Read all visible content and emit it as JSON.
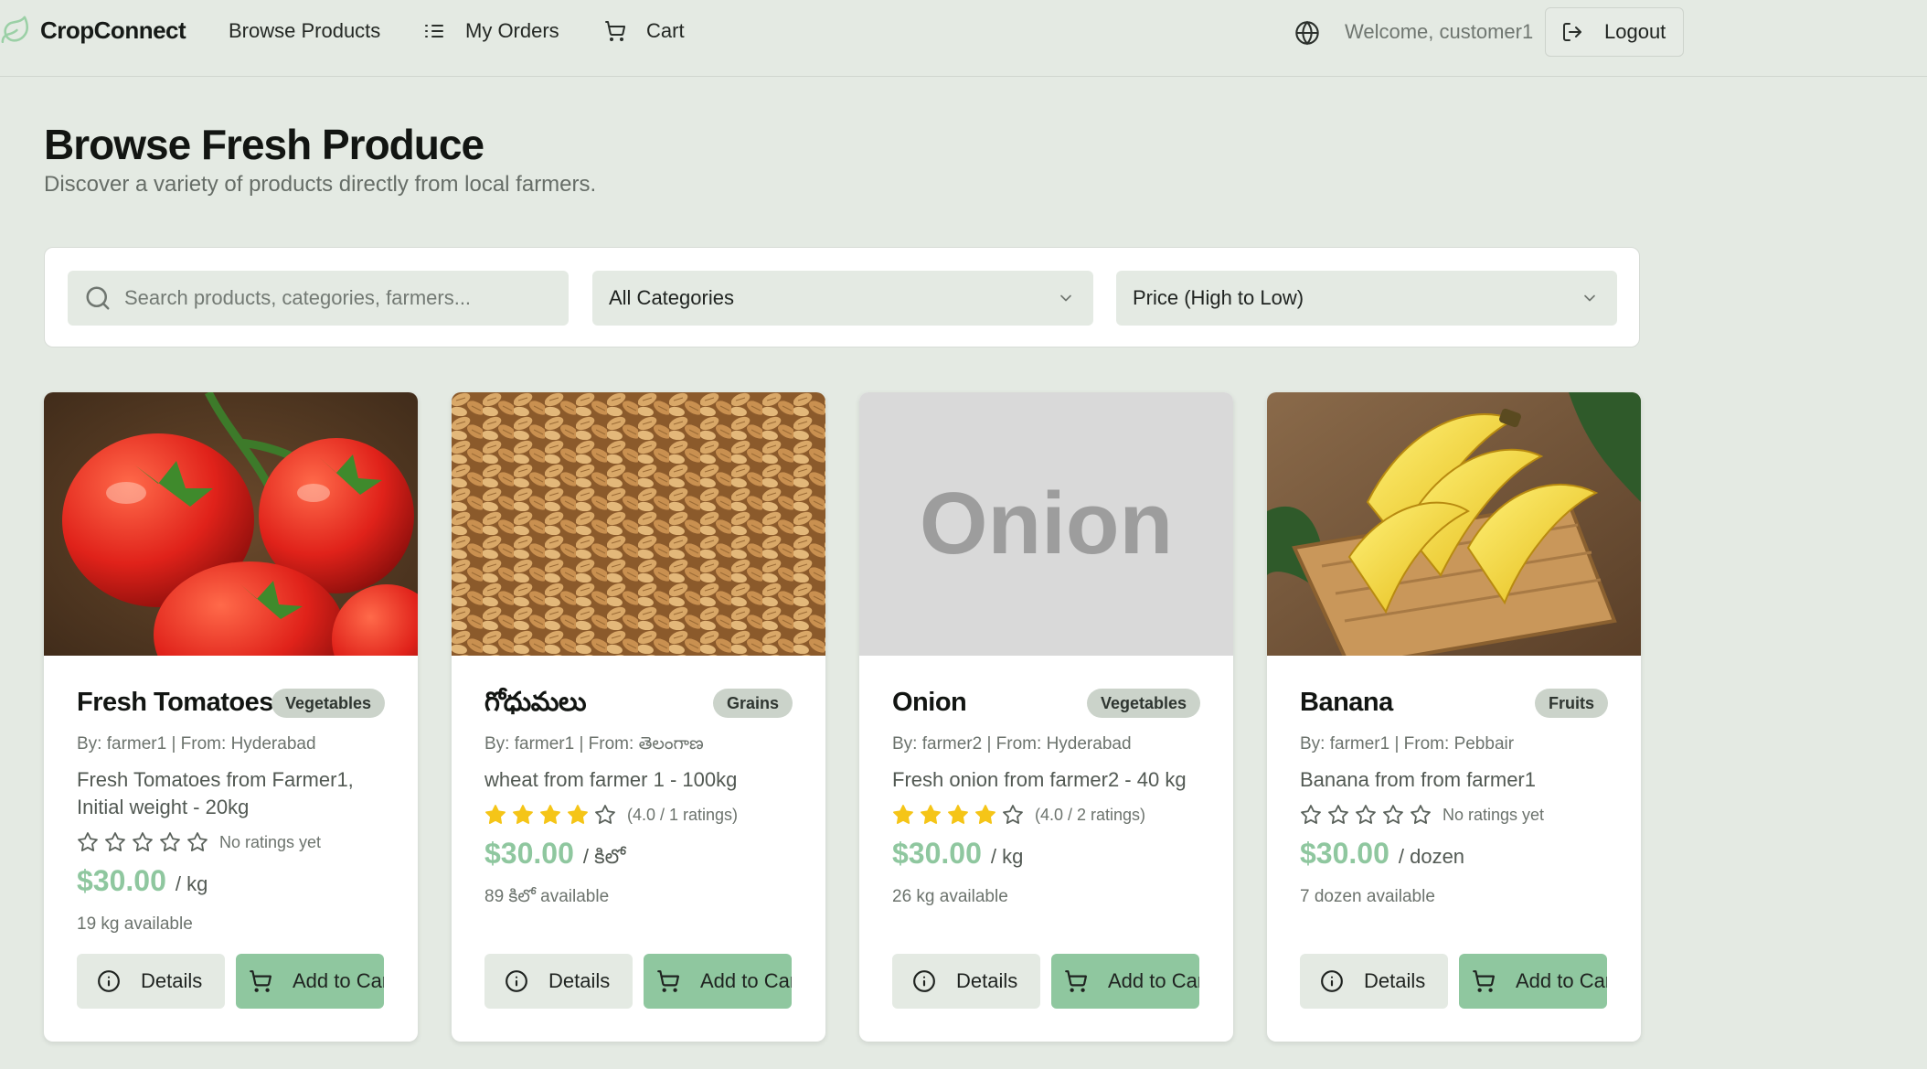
{
  "nav": {
    "brand": "CropConnect",
    "browse": "Browse Products",
    "orders": "My Orders",
    "cart": "Cart",
    "welcome": "Welcome, customer1",
    "logout": "Logout"
  },
  "header": {
    "title": "Browse Fresh Produce",
    "subtitle": "Discover a variety of products directly from local farmers."
  },
  "filters": {
    "search_placeholder": "Search products, categories, farmers...",
    "category": "All Categories",
    "sort": "Price (High to Low)"
  },
  "products": [
    {
      "name": "Fresh Tomatoes",
      "category": "Vegetables",
      "meta": "By: farmer1 | From: Hyderabad",
      "description": "Fresh Tomatoes from Farmer1, Initial weight - 20kg",
      "stars": 0,
      "rating_text": "No ratings yet",
      "price": "$30.00",
      "unit": "/ kg",
      "available": "19 kg available",
      "details_label": "Details",
      "cart_label": "Add to Cart"
    },
    {
      "name": "గోధుమలు",
      "category": "Grains",
      "meta": "By: farmer1 | From: తెలంగాణ",
      "description": "wheat from farmer 1 - 100kg",
      "stars": 4,
      "rating_text": "(4.0 / 1 ratings)",
      "price": "$30.00",
      "unit": "/ కిలో",
      "available": "89 కిలో available",
      "details_label": "Details",
      "cart_label": "Add to Cart"
    },
    {
      "name": "Onion",
      "category": "Vegetables",
      "meta": "By: farmer2 | From: Hyderabad",
      "description": "Fresh onion from farmer2 - 40 kg",
      "stars": 4,
      "rating_text": "(4.0 / 2 ratings)",
      "price": "$30.00",
      "unit": "/ kg",
      "available": "26 kg available",
      "image_text": "Onion",
      "details_label": "Details",
      "cart_label": "Add to Cart"
    },
    {
      "name": "Banana",
      "category": "Fruits",
      "meta": "By: farmer1 | From: Pebbair",
      "description": "Banana from from farmer1",
      "stars": 0,
      "rating_text": "No ratings yet",
      "price": "$30.00",
      "unit": "/ dozen",
      "available": "7 dozen available",
      "details_label": "Details",
      "cart_label": "Add to Cart"
    }
  ],
  "colors": {
    "background": "#e4eae3",
    "accent_green": "#8fc79f",
    "star": "#f5c518",
    "badge": "#cbd3ca"
  },
  "icons": [
    "leaf-icon",
    "list-icon",
    "cart-icon",
    "globe-icon",
    "logout-icon",
    "search-icon",
    "chevron-down-icon",
    "star-icon",
    "info-icon"
  ]
}
